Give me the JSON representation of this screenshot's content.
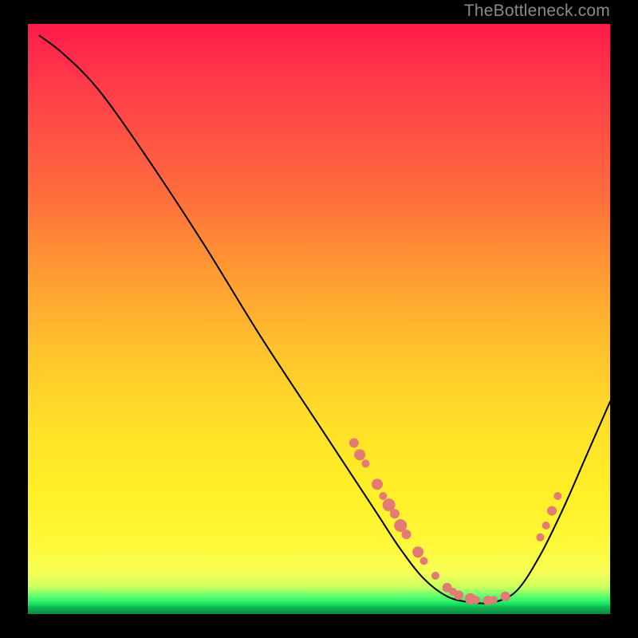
{
  "watermark": "TheBottleneck.com",
  "dot_color": "#e47a74",
  "chart_data": {
    "type": "line",
    "title": "",
    "xlabel": "",
    "ylabel": "",
    "ylim": [
      0,
      100
    ],
    "xlim": [
      0,
      100
    ],
    "curve": [
      {
        "x": 2,
        "y": 98
      },
      {
        "x": 6,
        "y": 95
      },
      {
        "x": 12,
        "y": 89
      },
      {
        "x": 20,
        "y": 78
      },
      {
        "x": 30,
        "y": 63
      },
      {
        "x": 40,
        "y": 47
      },
      {
        "x": 50,
        "y": 32
      },
      {
        "x": 56,
        "y": 23
      },
      {
        "x": 60,
        "y": 17
      },
      {
        "x": 64,
        "y": 11
      },
      {
        "x": 68,
        "y": 6
      },
      {
        "x": 72,
        "y": 3
      },
      {
        "x": 76,
        "y": 2
      },
      {
        "x": 80,
        "y": 2
      },
      {
        "x": 84,
        "y": 4
      },
      {
        "x": 88,
        "y": 10
      },
      {
        "x": 92,
        "y": 18
      },
      {
        "x": 96,
        "y": 27
      },
      {
        "x": 100,
        "y": 36
      }
    ],
    "markers": [
      {
        "x": 56,
        "y": 29,
        "r": 6
      },
      {
        "x": 57,
        "y": 27,
        "r": 7
      },
      {
        "x": 58,
        "y": 25.5,
        "r": 5
      },
      {
        "x": 60,
        "y": 22,
        "r": 7
      },
      {
        "x": 61,
        "y": 20,
        "r": 5
      },
      {
        "x": 62,
        "y": 18.5,
        "r": 8
      },
      {
        "x": 63,
        "y": 17,
        "r": 6
      },
      {
        "x": 64,
        "y": 15,
        "r": 8
      },
      {
        "x": 65,
        "y": 13.5,
        "r": 6
      },
      {
        "x": 67,
        "y": 10.5,
        "r": 7
      },
      {
        "x": 68,
        "y": 9,
        "r": 5
      },
      {
        "x": 70,
        "y": 6.5,
        "r": 5
      },
      {
        "x": 72,
        "y": 4.5,
        "r": 6
      },
      {
        "x": 73,
        "y": 3.8,
        "r": 5
      },
      {
        "x": 74,
        "y": 3.2,
        "r": 6
      },
      {
        "x": 76,
        "y": 2.6,
        "r": 7
      },
      {
        "x": 77,
        "y": 2.4,
        "r": 5
      },
      {
        "x": 79,
        "y": 2.3,
        "r": 6
      },
      {
        "x": 80,
        "y": 2.4,
        "r": 5
      },
      {
        "x": 82,
        "y": 3.0,
        "r": 6
      },
      {
        "x": 88,
        "y": 13,
        "r": 5
      },
      {
        "x": 89,
        "y": 15,
        "r": 5
      },
      {
        "x": 90,
        "y": 17.5,
        "r": 6
      },
      {
        "x": 91,
        "y": 20,
        "r": 5
      }
    ]
  }
}
